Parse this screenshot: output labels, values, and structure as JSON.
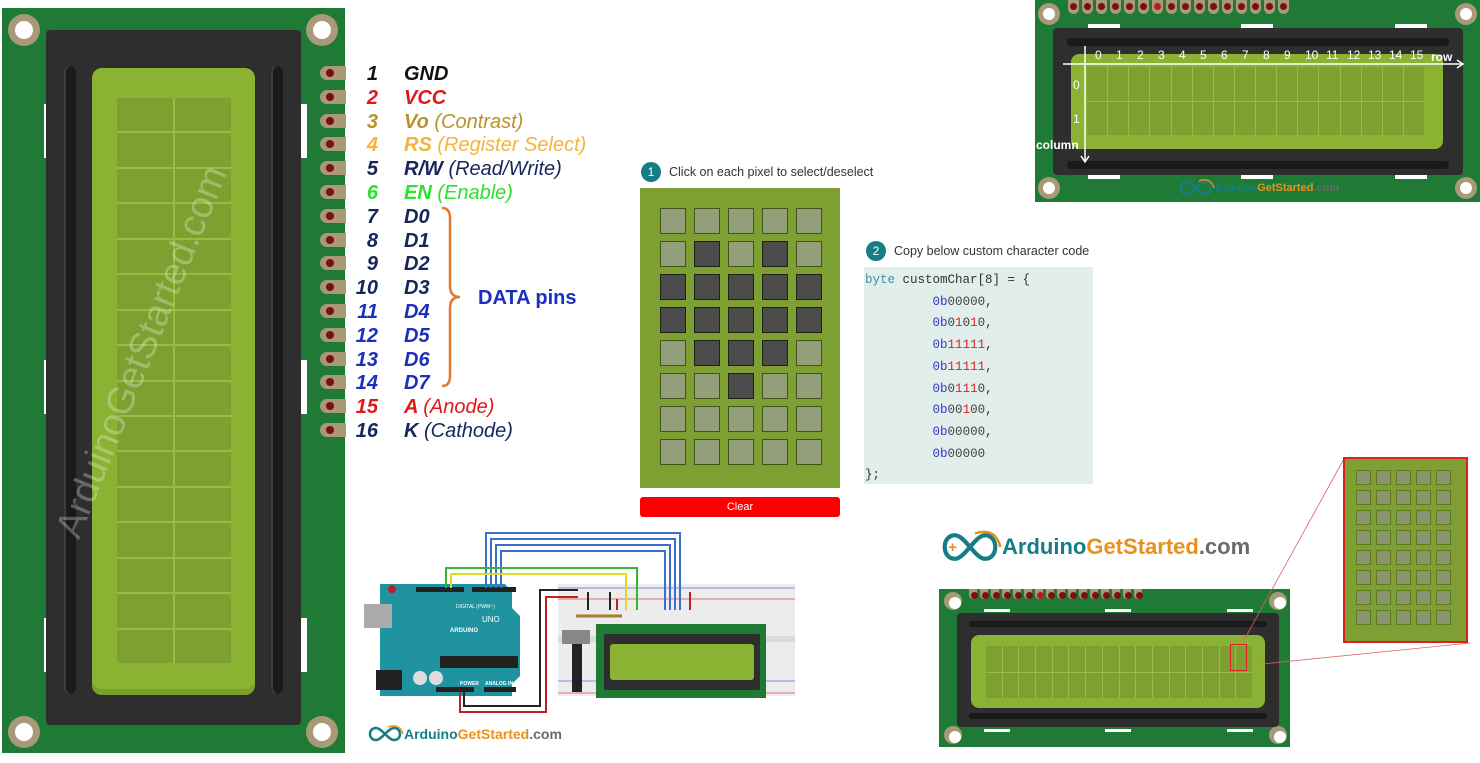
{
  "pinout": {
    "pins": [
      {
        "num": "1",
        "name": "GND",
        "desc": "",
        "color": "#111111"
      },
      {
        "num": "2",
        "name": "VCC",
        "desc": "",
        "color": "#e01818"
      },
      {
        "num": "3",
        "name": "Vo",
        "desc": "(Contrast)",
        "color": "#b8922a"
      },
      {
        "num": "4",
        "name": "RS",
        "desc": "(Register Select)",
        "color": "#f2b53a"
      },
      {
        "num": "5",
        "name": "R/W",
        "desc": "(Read/Write)",
        "color": "#16265a"
      },
      {
        "num": "6",
        "name": "EN",
        "desc": "(Enable)",
        "color": "#2ee02e"
      },
      {
        "num": "7",
        "name": "D0",
        "desc": "",
        "color": "#16265a"
      },
      {
        "num": "8",
        "name": "D1",
        "desc": "",
        "color": "#16265a"
      },
      {
        "num": "9",
        "name": "D2",
        "desc": "",
        "color": "#16265a"
      },
      {
        "num": "10",
        "name": "D3",
        "desc": "",
        "color": "#16265a"
      },
      {
        "num": "11",
        "name": "D4",
        "desc": "",
        "color": "#1a2fc0"
      },
      {
        "num": "12",
        "name": "D5",
        "desc": "",
        "color": "#1a2fc0"
      },
      {
        "num": "13",
        "name": "D6",
        "desc": "",
        "color": "#1a2fc0"
      },
      {
        "num": "14",
        "name": "D7",
        "desc": "",
        "color": "#1a2fc0"
      },
      {
        "num": "15",
        "name": "A",
        "desc": "(Anode)",
        "color": "#e01818"
      },
      {
        "num": "16",
        "name": "K",
        "desc": "(Cathode)",
        "color": "#16265a"
      }
    ],
    "data_pins_label": "DATA pins",
    "watermark": "ArduinoGetStarted.com"
  },
  "editor": {
    "step1_num": "1",
    "step1_label": "Click on each pixel to select/deselect",
    "pixels": [
      [
        0,
        0,
        0,
        0,
        0
      ],
      [
        0,
        1,
        0,
        1,
        0
      ],
      [
        1,
        1,
        1,
        1,
        1
      ],
      [
        1,
        1,
        1,
        1,
        1
      ],
      [
        0,
        1,
        1,
        1,
        0
      ],
      [
        0,
        0,
        1,
        0,
        0
      ],
      [
        0,
        0,
        0,
        0,
        0
      ],
      [
        0,
        0,
        0,
        0,
        0
      ]
    ],
    "clear_label": "Clear"
  },
  "code": {
    "step2_num": "2",
    "step2_label": "Copy below custom character code",
    "keyword": "byte",
    "declaration": " customChar[8] = {",
    "rows": [
      "00000",
      "01010",
      "11111",
      "11111",
      "01110",
      "00100",
      "00000",
      "00000"
    ],
    "prefix": "0b",
    "closing": "};"
  },
  "lcd_diagram": {
    "row_label": "row",
    "column_label": "column",
    "col_indices": [
      "0",
      "1",
      "2",
      "3",
      "4",
      "5",
      "6",
      "7",
      "8",
      "9",
      "10",
      "11",
      "12",
      "13",
      "14",
      "15"
    ],
    "row_indices": [
      "0",
      "1"
    ],
    "logo": {
      "a": "Arduino",
      "g": "Get",
      "s": "Started",
      "c": ".com"
    }
  },
  "wiring": {
    "board_label": "ARDUINO",
    "uno_label": "UNO",
    "digital_label": "DIGITAL (PWM~)",
    "power_label": "POWER",
    "analog_label": "ANALOG IN",
    "logo": {
      "a": "Arduino",
      "g": "Get",
      "s": "Started",
      "c": ".com"
    }
  },
  "branding": {
    "logo": {
      "a": "Arduino",
      "g": "Get",
      "s": "Started",
      "c": ".com"
    }
  }
}
